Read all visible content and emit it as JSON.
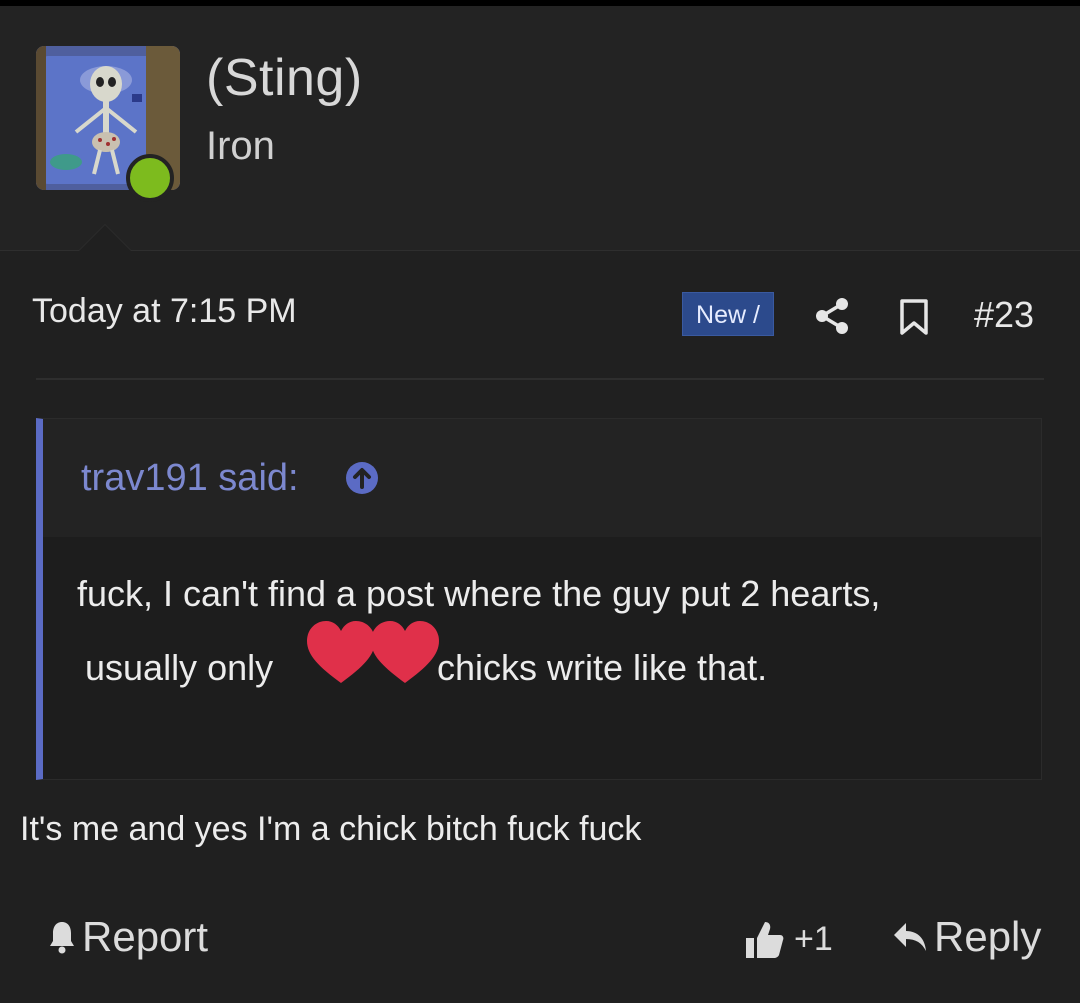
{
  "post": {
    "username": "(Sting)",
    "user_title": "Iron",
    "date": "Today at 7:15 PM",
    "new_badge": "New /",
    "post_number": "#23"
  },
  "quote": {
    "author": "trav191 said:",
    "line1": "fuck, I can't find a post where the guy put 2 hearts,",
    "line2_before": "usually only",
    "line2_after": "chicks write like that."
  },
  "body": {
    "text": "It's me and yes I'm a chick bitch fuck fuck"
  },
  "actions": {
    "report": "Report",
    "like_count": "+1",
    "reply": "Reply"
  },
  "colors": {
    "background": "#202020",
    "accent": "#5b6bc4",
    "online": "#7dbb1e",
    "badge": "#2c4a8c",
    "heart": "#e0304a"
  },
  "icons": [
    "share-icon",
    "bookmark-icon",
    "up-arrow-icon",
    "hearts-icon",
    "bell-icon",
    "thumbs-up-icon",
    "reply-arrow-icon"
  ]
}
